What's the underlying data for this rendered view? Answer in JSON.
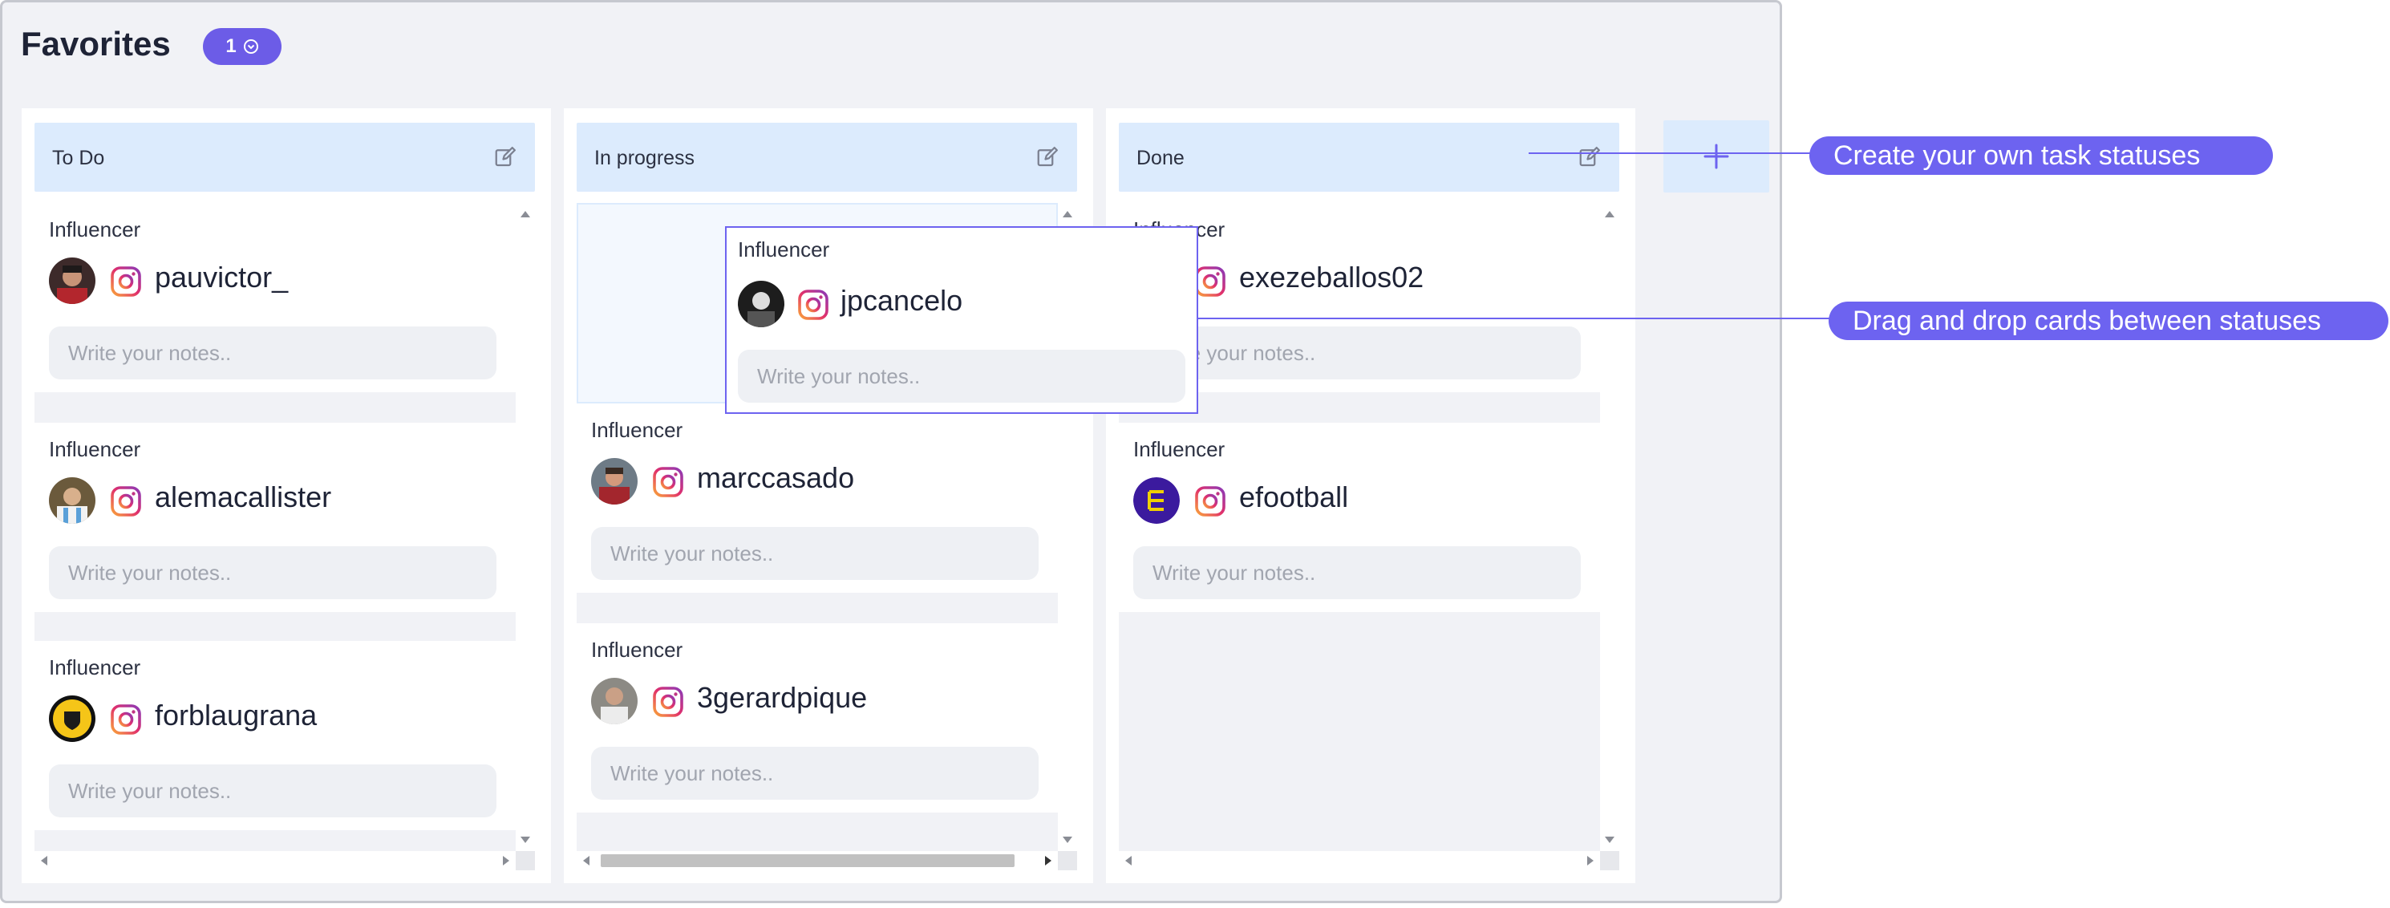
{
  "page": {
    "title": "Favorites",
    "count": "1"
  },
  "columns": [
    {
      "title": "To Do",
      "cards": [
        {
          "type": "Influencer",
          "handle": "pauvictor_",
          "notes_placeholder": "Write your notes.."
        },
        {
          "type": "Influencer",
          "handle": "alemacallister",
          "notes_placeholder": "Write your notes.."
        },
        {
          "type": "Influencer",
          "handle": "forblaugrana",
          "notes_placeholder": "Write your notes.."
        }
      ]
    },
    {
      "title": "In progress",
      "cards": [
        {
          "type": "Influencer",
          "handle": "marccasado",
          "notes_placeholder": "Write your notes.."
        },
        {
          "type": "Influencer",
          "handle": "3gerardpique",
          "notes_placeholder": "Write your notes.."
        }
      ]
    },
    {
      "title": "Done",
      "cards": [
        {
          "type": "Influencer",
          "handle": "exezeballos02",
          "notes_placeholder": "Write your notes.."
        },
        {
          "type": "Influencer",
          "handle": "efootball",
          "notes_placeholder": "Write your notes.."
        }
      ]
    }
  ],
  "dragging_card": {
    "type": "Influencer",
    "handle": "jpcancelo",
    "notes_placeholder": "Write your notes.."
  },
  "callouts": {
    "statuses": "Create your own task statuses",
    "drag": "Drag and drop cards between statuses"
  },
  "colors": {
    "accent": "#6d63f0",
    "header": "#dcebfd",
    "background": "#f1f2f6"
  },
  "icons": {
    "edit": "edit-icon",
    "platform": "instagram-icon",
    "add": "plus-icon",
    "badge": "chevron-down-circle-icon"
  }
}
